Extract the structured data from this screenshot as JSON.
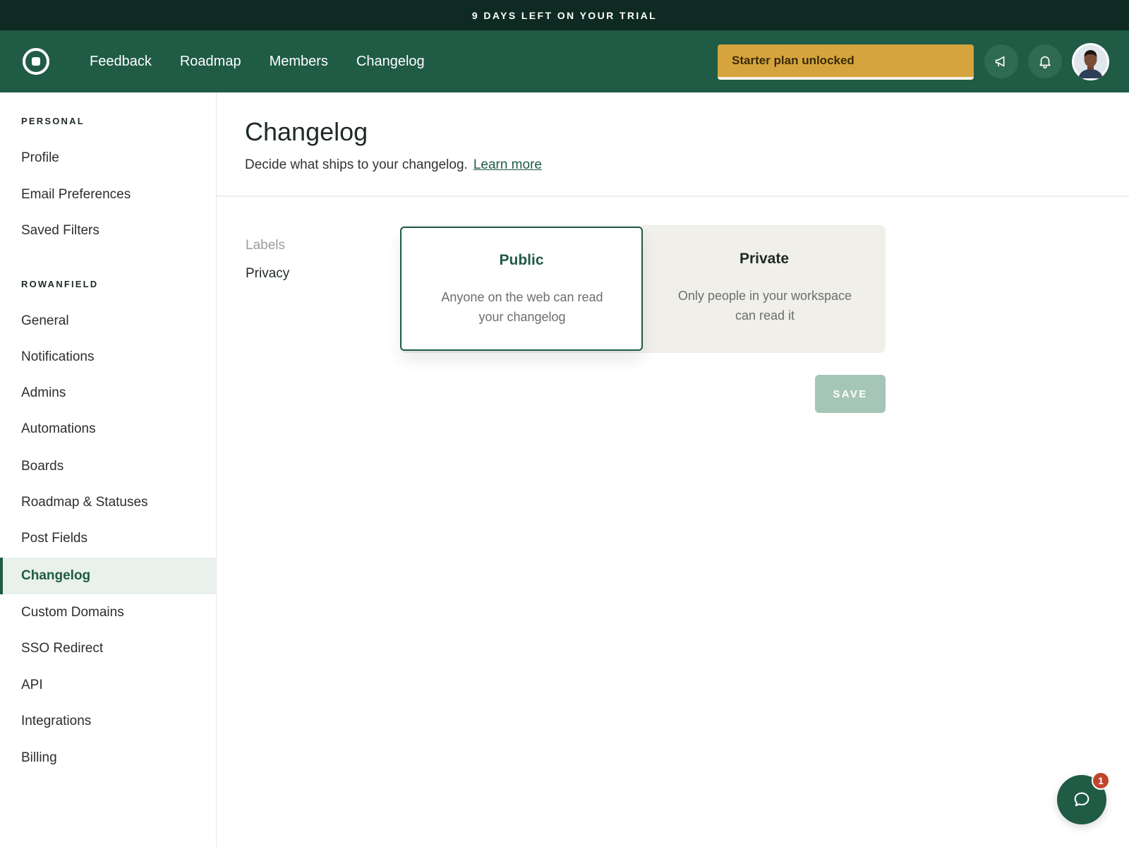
{
  "trial_banner": "9 DAYS LEFT ON YOUR TRIAL",
  "topnav": {
    "links": [
      "Feedback",
      "Roadmap",
      "Members",
      "Changelog"
    ],
    "plan_button": "Starter plan unlocked",
    "icons": {
      "logo": "logo-icon",
      "announce": "megaphone-icon",
      "notifications": "bell-icon",
      "avatar": "user-avatar"
    }
  },
  "sidebar": {
    "personal_heading": "PERSONAL",
    "personal_items": [
      "Profile",
      "Email Preferences",
      "Saved Filters"
    ],
    "workspace_heading": "ROWANFIELD",
    "workspace_items": [
      "General",
      "Notifications",
      "Admins",
      "Automations",
      "Boards",
      "Roadmap & Statuses",
      "Post Fields",
      "Changelog",
      "Custom Domains",
      "SSO Redirect",
      "API",
      "Integrations",
      "Billing"
    ],
    "active_item": "Changelog"
  },
  "main": {
    "title": "Changelog",
    "subtitle": "Decide what ships to your changelog.",
    "learn_more": "Learn more",
    "subnav": [
      "Labels",
      "Privacy"
    ],
    "privacy_options": [
      {
        "title": "Public",
        "description": "Anyone on the web can read your changelog",
        "selected": true
      },
      {
        "title": "Private",
        "description": "Only people in your workspace can read it",
        "selected": false
      }
    ],
    "save_label": "SAVE"
  },
  "chat": {
    "badge_count": "1"
  },
  "colors": {
    "brand_green": "#1f5b45",
    "trial_bar": "#0e2a22",
    "plan_button": "#d6a43e",
    "save_disabled": "#a5c5b7",
    "badge": "#c0452c"
  }
}
